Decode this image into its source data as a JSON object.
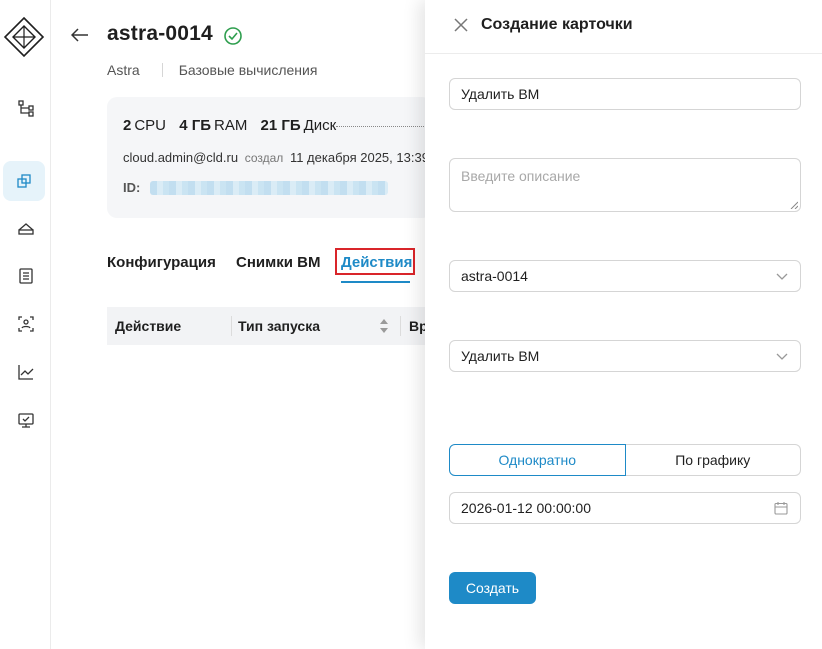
{
  "page": {
    "title": "astra-0014",
    "breadcrumb": [
      "Astra",
      "Базовые вычисления"
    ]
  },
  "card": {
    "cpu_value": "2",
    "cpu_unit": "CPU",
    "ram_value": "4 ГБ",
    "ram_unit": "RAM",
    "disk_value": "21 ГБ",
    "disk_unit": "Диск",
    "owner": "cloud.admin@cld.ru",
    "created_label": "создал",
    "created_at": "11 декабря 2025, 13:39",
    "id_label": "ID:"
  },
  "tabs": [
    {
      "label": "Конфигурация"
    },
    {
      "label": "Снимки ВМ"
    },
    {
      "label": "Действия",
      "active": true
    }
  ],
  "table": {
    "columns": [
      "Действие",
      "Тип запуска",
      "Вр"
    ]
  },
  "drawer": {
    "title": "Создание карточки",
    "name_value": "Удалить ВМ",
    "description_placeholder": "Введите описание",
    "vm_select": "astra-0014",
    "action_select": "Удалить ВМ",
    "schedule_options": [
      "Однократно",
      "По графику"
    ],
    "selected_schedule": "Однократно",
    "datetime_value": "2026-01-12 00:00:00",
    "submit_label": "Создать"
  },
  "colors": {
    "accent": "#1e8ac7",
    "success": "#2e9e4e",
    "highlight": "#d9252a"
  }
}
